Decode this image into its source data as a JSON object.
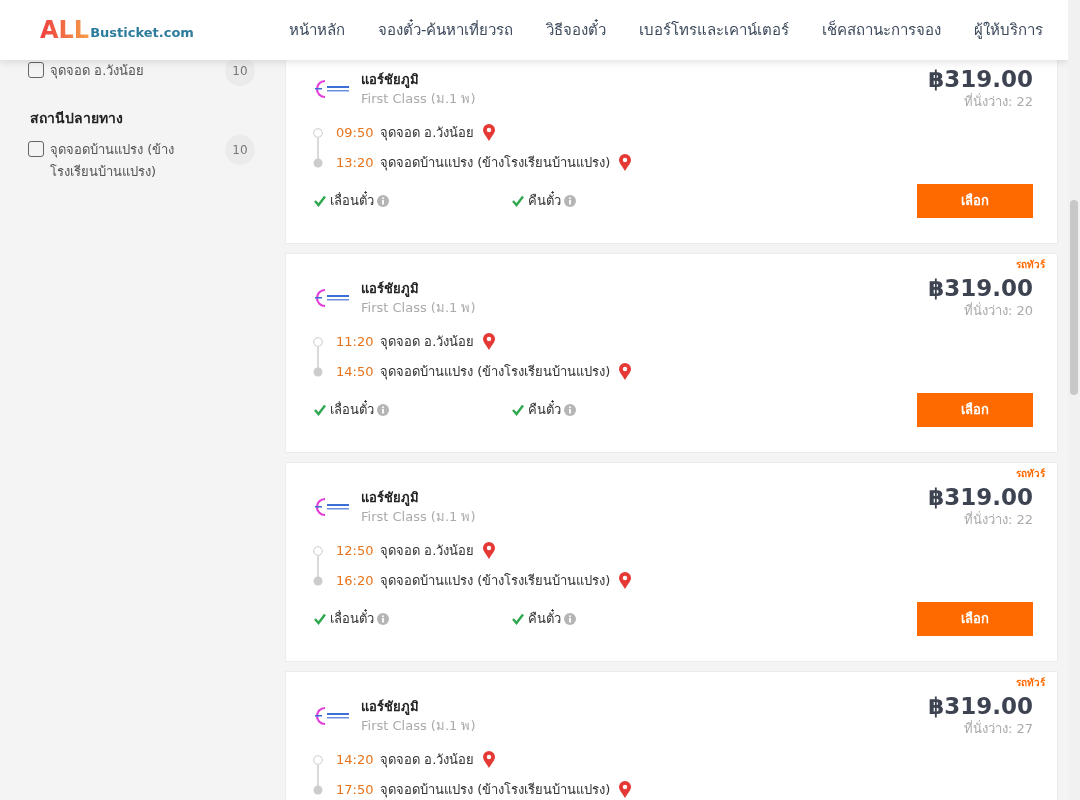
{
  "header": {
    "logo": {
      "main": "ALL",
      "rest": "Busticket.com"
    },
    "nav": [
      "หน้าหลัก",
      "จองตั๋ว-ค้นหาเที่ยวรถ",
      "วิธีจองตั๋ว",
      "เบอร์โทรและเคาน์เตอร์",
      "เช็คสถานะการจอง",
      "ผู้ให้บริการ"
    ]
  },
  "sidebar": {
    "groups": [
      {
        "items": [
          {
            "label": "จุดจอด อ.วังน้อย",
            "count": "10",
            "checked": false
          }
        ]
      },
      {
        "title": "สถานีปลายทาง",
        "items": [
          {
            "label": "จุดจอดบ้านแปรง (ข้างโรงเรียนบ้านแปรง)",
            "count": "10",
            "checked": false
          }
        ]
      }
    ]
  },
  "trips": [
    {
      "operator": "แอร์ชัยภูมิ",
      "class": "First Class (ม.1 พ)",
      "price": "฿319.00",
      "seats": "ที่นั่งว่าง: 22",
      "stops": [
        {
          "time": "09:50",
          "place": "จุดจอด อ.วังน้อย",
          "kind": "departure"
        },
        {
          "time": "13:20",
          "place": "จุดจอดบ้านแปรง (ข้างโรงเรียนบ้านแปรง)",
          "kind": "arrival"
        }
      ],
      "features": [
        {
          "label": "เลื่อนตั๋ว",
          "available": true
        },
        {
          "label": "คืนตั๋ว",
          "available": true
        }
      ],
      "button": "เลือก"
    },
    {
      "tag": "รถทัวร์",
      "operator": "แอร์ชัยภูมิ",
      "class": "First Class (ม.1 พ)",
      "price": "฿319.00",
      "seats": "ที่นั่งว่าง: 20",
      "stops": [
        {
          "time": "11:20",
          "place": "จุดจอด อ.วังน้อย",
          "kind": "departure"
        },
        {
          "time": "14:50",
          "place": "จุดจอดบ้านแปรง (ข้างโรงเรียนบ้านแปรง)",
          "kind": "arrival"
        }
      ],
      "features": [
        {
          "label": "เลื่อนตั๋ว",
          "available": true
        },
        {
          "label": "คืนตั๋ว",
          "available": true
        }
      ],
      "button": "เลือก"
    },
    {
      "tag": "รถทัวร์",
      "operator": "แอร์ชัยภูมิ",
      "class": "First Class (ม.1 พ)",
      "price": "฿319.00",
      "seats": "ที่นั่งว่าง: 22",
      "stops": [
        {
          "time": "12:50",
          "place": "จุดจอด อ.วังน้อย",
          "kind": "departure"
        },
        {
          "time": "16:20",
          "place": "จุดจอดบ้านแปรง (ข้างโรงเรียนบ้านแปรง)",
          "kind": "arrival"
        }
      ],
      "features": [
        {
          "label": "เลื่อนตั๋ว",
          "available": true
        },
        {
          "label": "คืนตั๋ว",
          "available": true
        }
      ],
      "button": "เลือก"
    },
    {
      "tag": "รถทัวร์",
      "operator": "แอร์ชัยภูมิ",
      "class": "First Class (ม.1 พ)",
      "price": "฿319.00",
      "seats": "ที่นั่งว่าง: 27",
      "stops": [
        {
          "time": "14:20",
          "place": "จุดจอด อ.วังน้อย",
          "kind": "departure"
        },
        {
          "time": "17:50",
          "place": "จุดจอดบ้านแปรง (ข้างโรงเรียนบ้านแปรง)",
          "kind": "arrival"
        }
      ]
    }
  ]
}
